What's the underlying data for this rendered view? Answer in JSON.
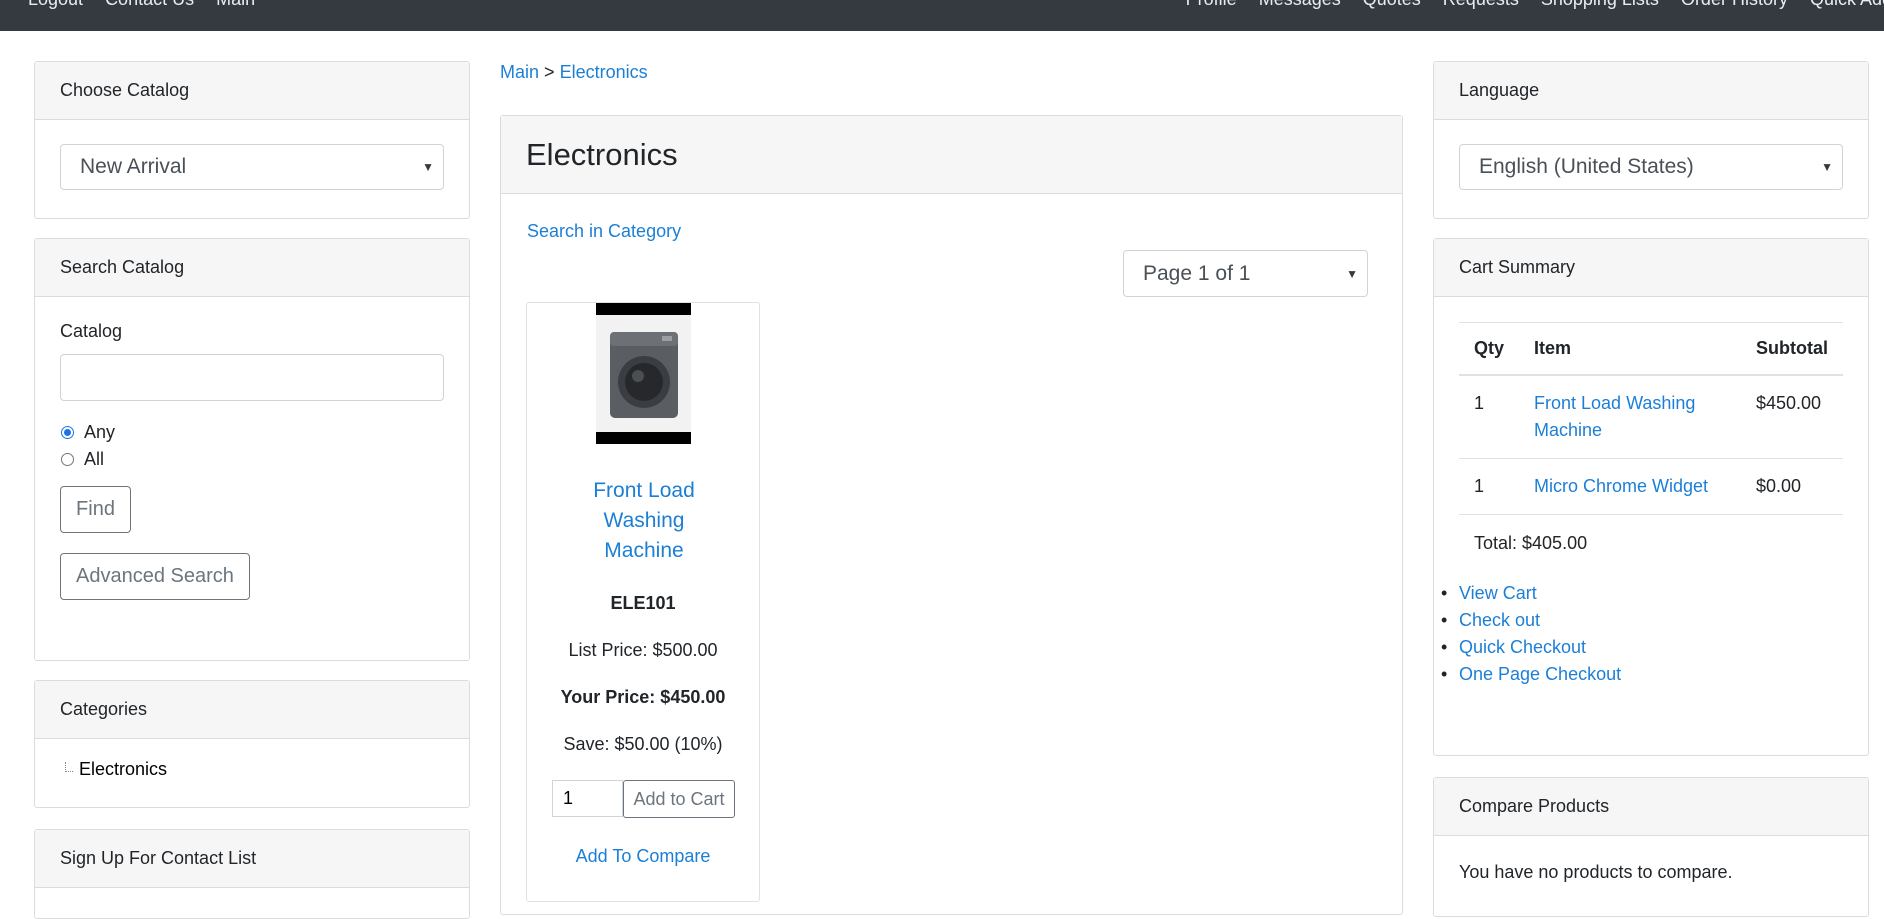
{
  "topnav": {
    "left": [
      "Logout",
      "Contact Us",
      "Main"
    ],
    "right": [
      "Profile",
      "Messages",
      "Quotes",
      "Requests",
      "Shopping Lists",
      "Order History",
      "Quick Add"
    ]
  },
  "choose_catalog": {
    "title": "Choose Catalog",
    "selected": "New Arrival"
  },
  "search_catalog": {
    "title": "Search Catalog",
    "catalog_label": "Catalog",
    "catalog_value": "",
    "any_label": "Any",
    "all_label": "All",
    "find_label": "Find",
    "advanced_label": "Advanced Search"
  },
  "categories": {
    "title": "Categories",
    "items": [
      "Electronics"
    ]
  },
  "signup": {
    "title": "Sign Up For Contact List"
  },
  "breadcrumb": {
    "main": "Main",
    "sep": ">",
    "current": "Electronics"
  },
  "category": {
    "title": "Electronics",
    "search_link": "Search in Category",
    "page_select": "Page 1 of 1"
  },
  "product": {
    "name": "Front Load Washing Machine",
    "sku": "ELE101",
    "list_price": "List Price: $500.00",
    "your_price": "Your Price: $450.00",
    "save": "Save: $50.00 (10%)",
    "qty": "1",
    "add_to_cart": "Add to Cart",
    "add_to_compare": "Add To Compare"
  },
  "language": {
    "title": "Language",
    "selected": "English (United States)"
  },
  "cart_summary": {
    "title": "Cart Summary",
    "headers": [
      "Qty",
      "Item",
      "Subtotal"
    ],
    "rows": [
      {
        "qty": "1",
        "item": "Front Load Washing Machine",
        "subtotal": "$450.00"
      },
      {
        "qty": "1",
        "item": "Micro Chrome Widget",
        "subtotal": "$0.00"
      }
    ],
    "total": "Total: $405.00",
    "links": [
      "View Cart",
      "Check out",
      "Quick Checkout",
      "One Page Checkout"
    ]
  },
  "compare": {
    "title": "Compare Products",
    "empty_text": "You have no products to compare."
  }
}
